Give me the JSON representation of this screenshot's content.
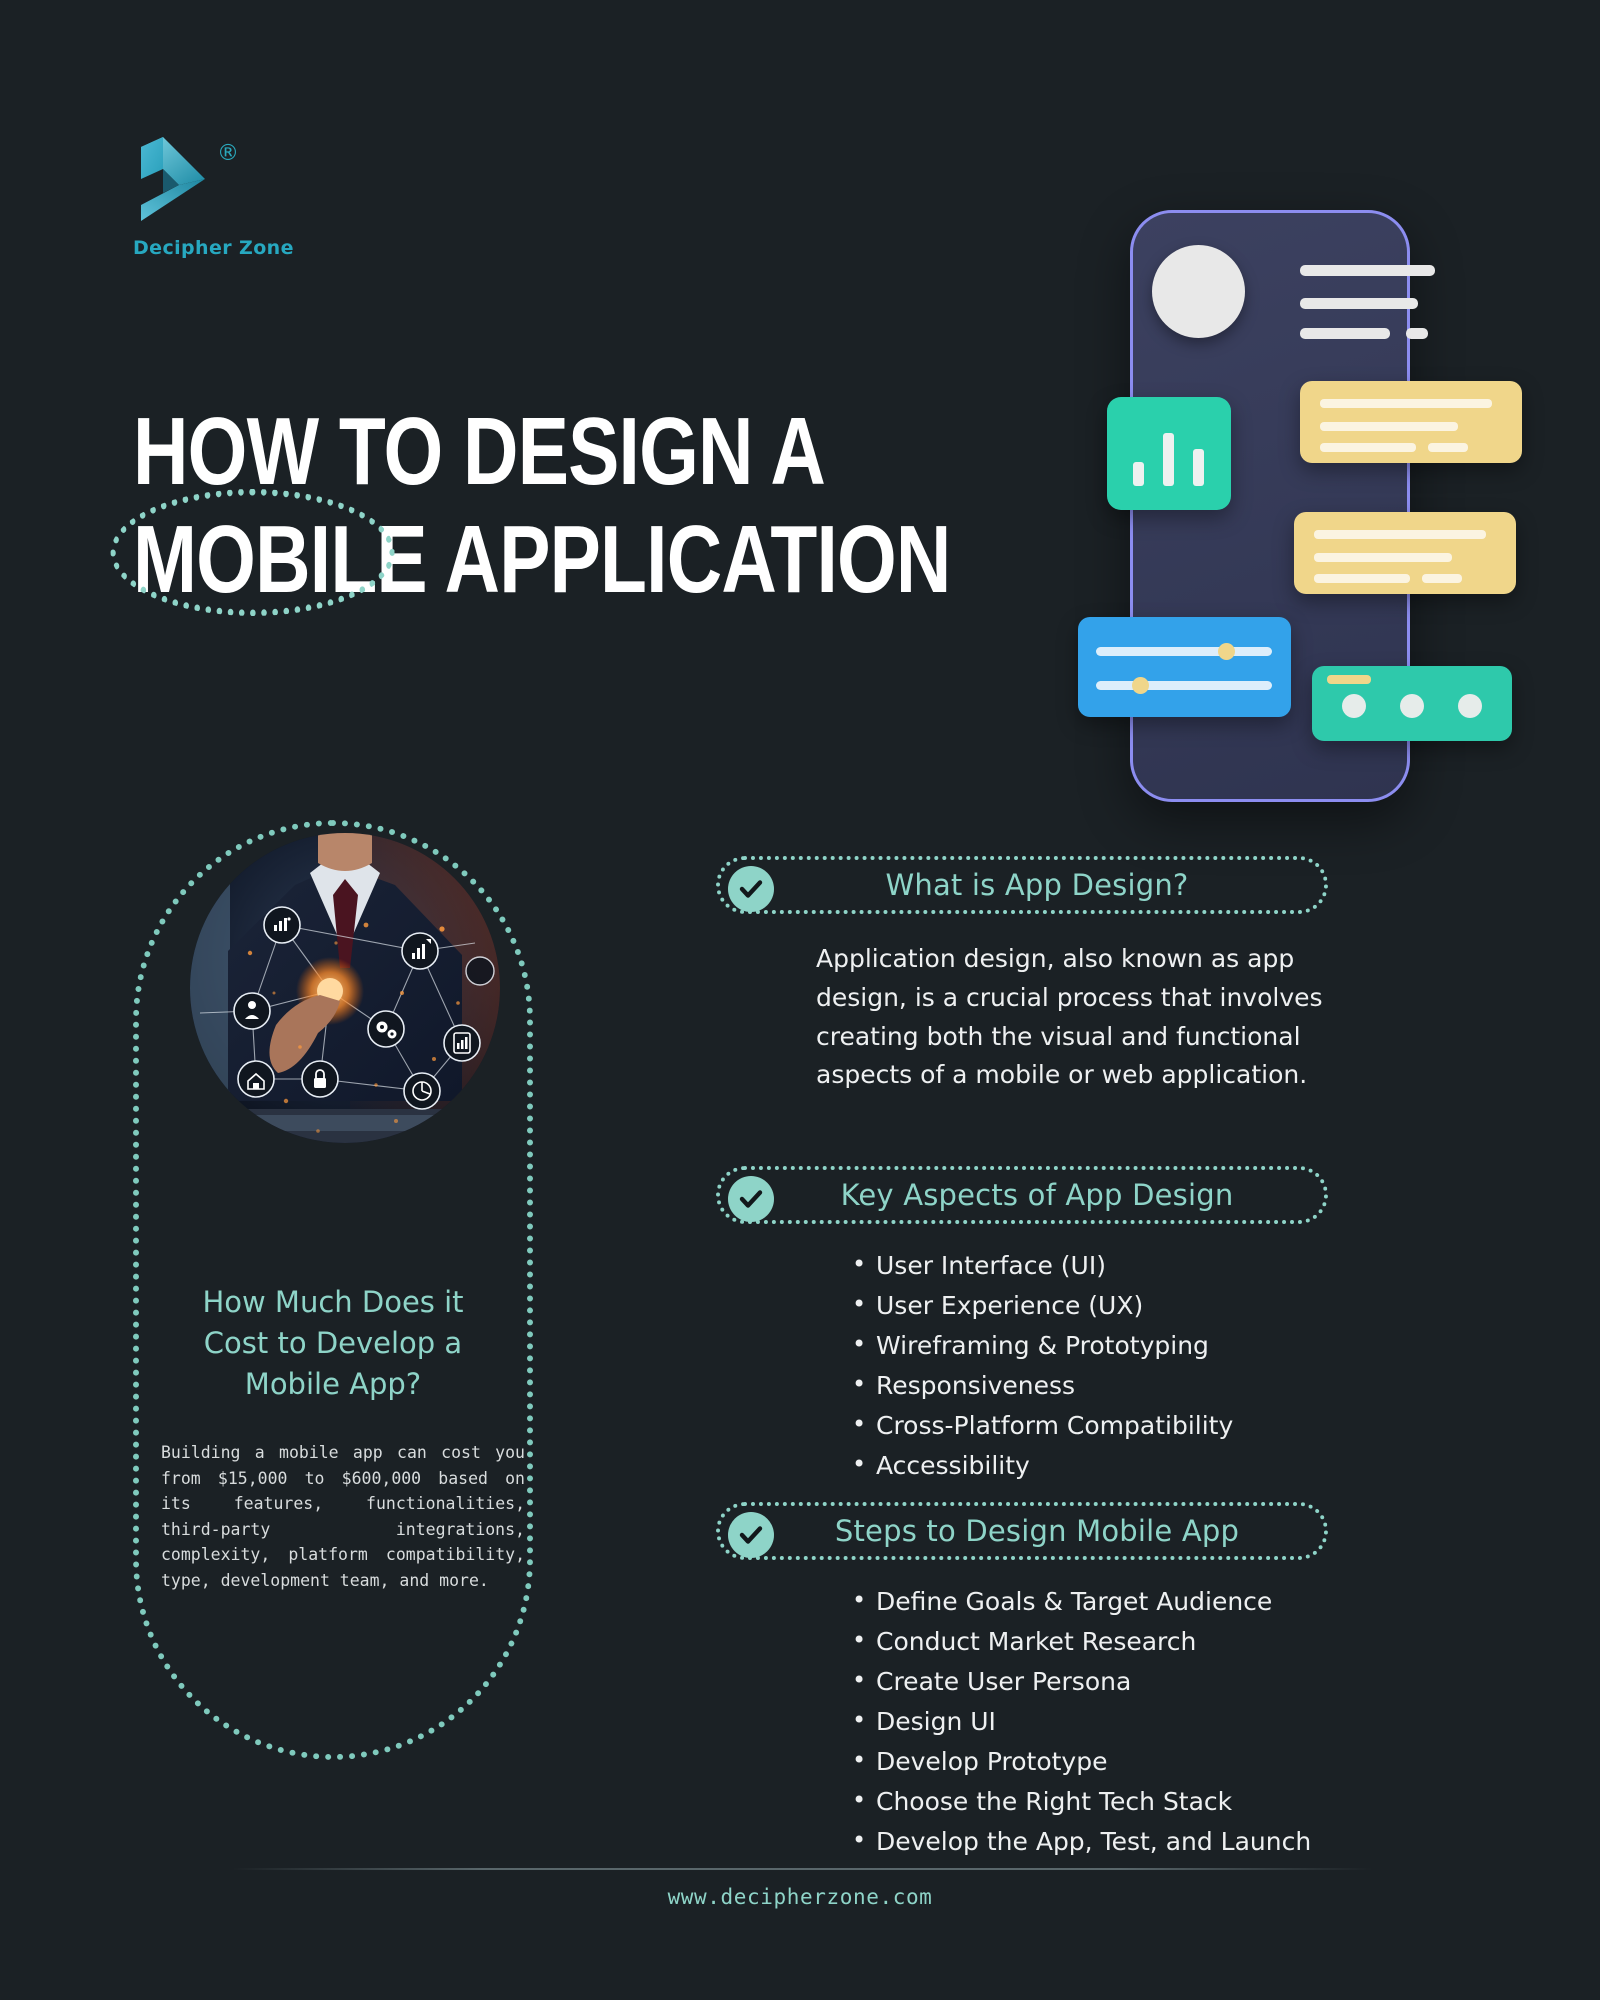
{
  "brand": {
    "name": "Decipher Zone",
    "registered_mark": "®",
    "logo_icon": "decipher-zone-logo",
    "accent_color": "#27a8c0"
  },
  "title": {
    "line1": "HOW TO DESIGN A",
    "line2": "MOBILE APPLICATION",
    "highlight_word": "MOBILE",
    "text_color": "#ffffff",
    "ring_color": "#8ed4c8"
  },
  "hero_illustration": {
    "name": "mobile-app-ui-illustration",
    "phone_border_color": "#8c8df0",
    "phone_body_color": "#3c4160",
    "chart_card_color": "#2ad0ac",
    "yellow_card_color": "#f0d68a",
    "blue_card_color": "#33a2ea",
    "teal_card_color": "#2ec9ab"
  },
  "left_panel": {
    "photo": {
      "name": "businessman-touching-network-icons-photo",
      "alt": "Businessman in a suit touching a glowing network of technology icons"
    },
    "heading": "How Much Does it Cost to Develop a Mobile App?",
    "body": "Building a mobile app can cost you from $15,000 to $600,000 based on its features, functionalities, third-party integrations, complexity, platform compatibility, type, development team, and more.",
    "cost_min": "$15,000",
    "cost_max": "$600,000",
    "heading_color": "#8ed4c8",
    "capsule_border_color": "#7fcabd"
  },
  "sections": [
    {
      "id": "what-is-app-design",
      "icon": "check-circle-icon",
      "title": "What is App Design?",
      "body": "Application design, also known as app design, is a crucial process that involves creating both the visual and functional aspects of a mobile or web application.",
      "items": []
    },
    {
      "id": "key-aspects-of-app-design",
      "icon": "check-circle-icon",
      "title": "Key Aspects of App Design",
      "body": "",
      "items": [
        "User Interface (UI)",
        "User Experience (UX)",
        "Wireframing & Prototyping",
        "Responsiveness",
        "Cross-Platform Compatibility",
        "Accessibility"
      ]
    },
    {
      "id": "steps-to-design-mobile-app",
      "icon": "check-circle-icon",
      "title": "Steps to Design Mobile App",
      "body": "",
      "items": [
        "Define Goals & Target Audience",
        "Conduct Market Research",
        "Create User Persona",
        "Design UI",
        "Develop Prototype",
        "Choose the Right Tech Stack",
        "Develop the App, Test, and Launch"
      ]
    }
  ],
  "footer": {
    "url": "www.decipherzone.com",
    "color": "#8ed4c8"
  },
  "theme": {
    "background": "#1b2125",
    "accent_mint": "#8ed4c8",
    "text_primary": "#eef0f1"
  }
}
